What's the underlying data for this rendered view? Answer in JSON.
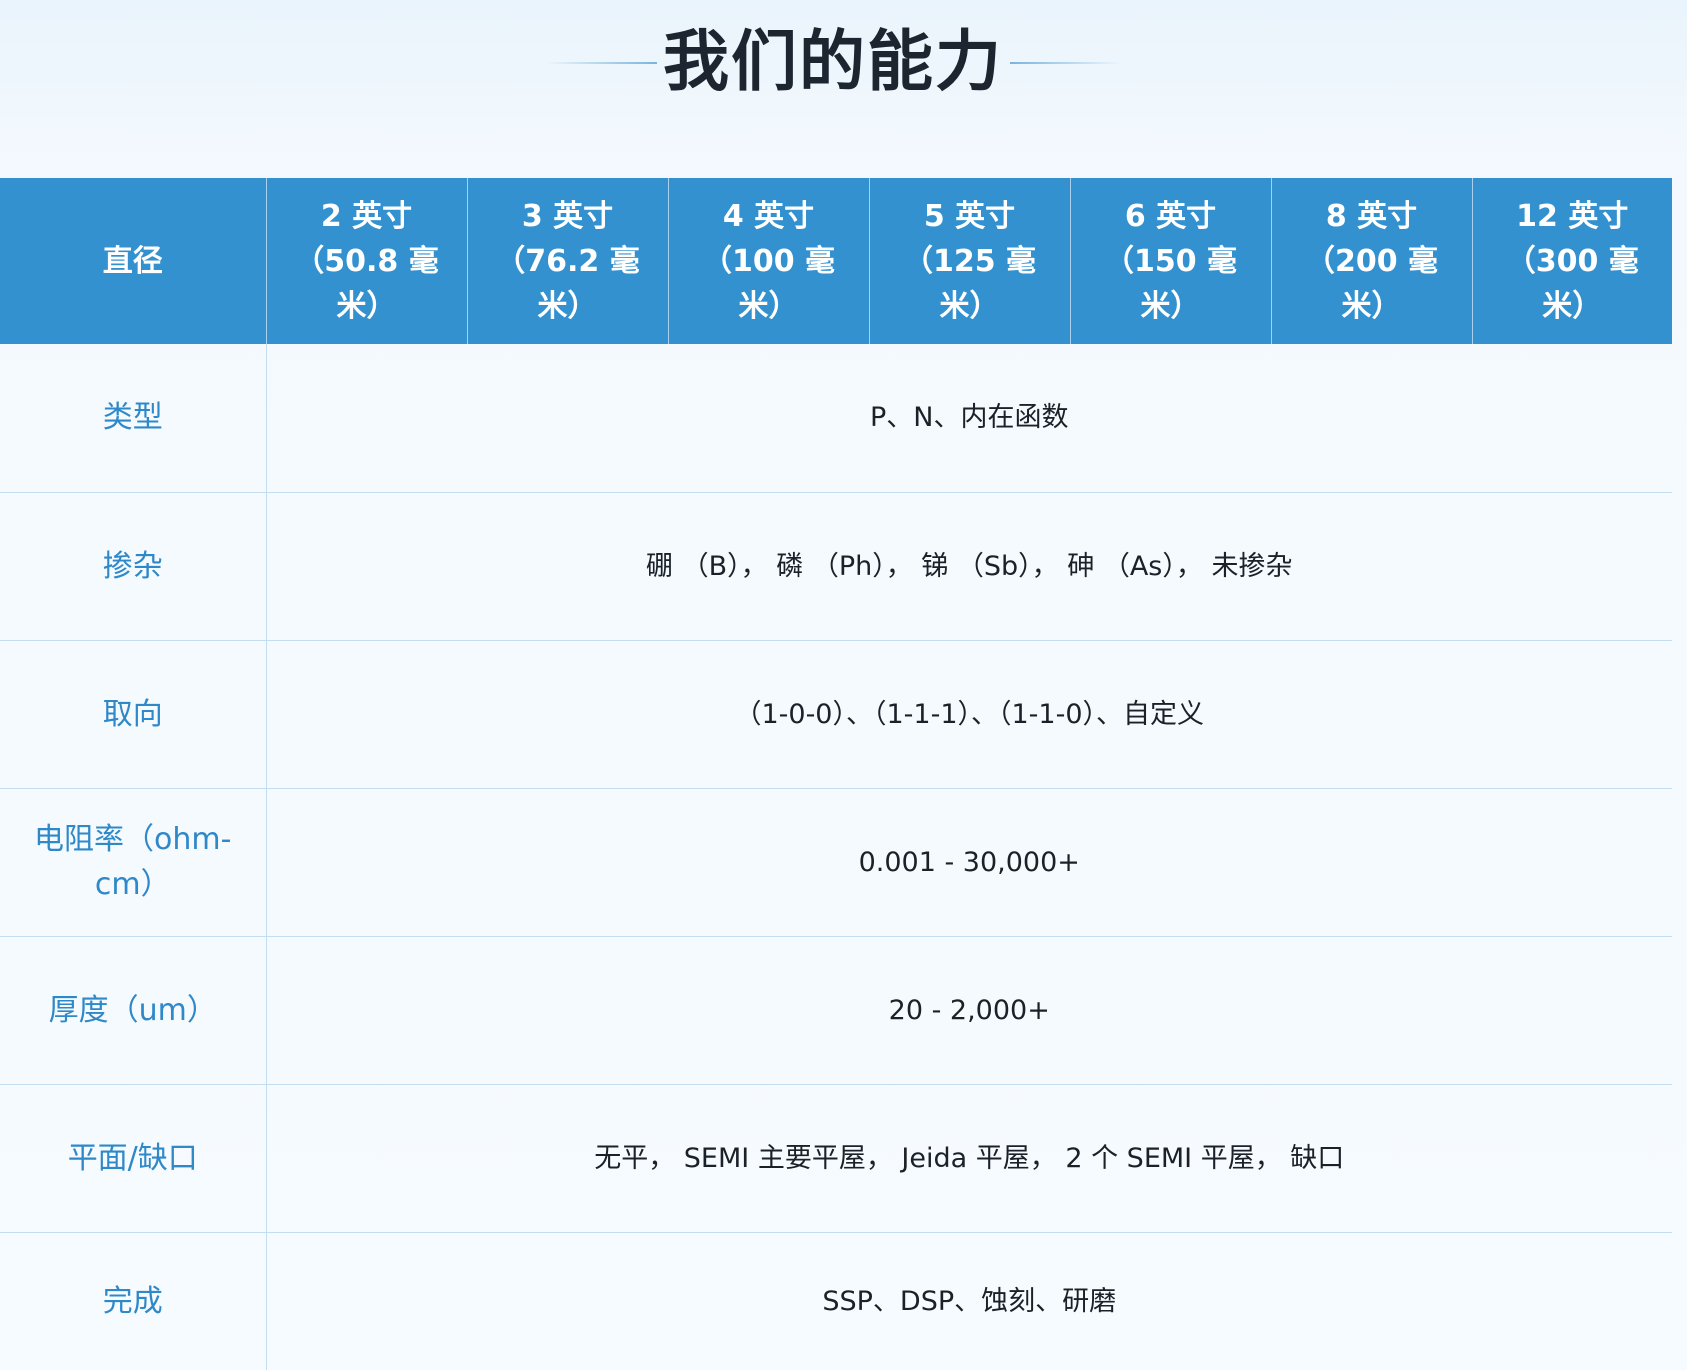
{
  "title": "我们的能力",
  "table": {
    "header_label": "直径",
    "columns": [
      "2 英寸（50.8 毫米）",
      "3 英寸（76.2 毫米）",
      "4 英寸（100 毫米）",
      "5 英寸（125 毫米）",
      "6 英寸（150 毫米）",
      "8 英寸（200 毫米）",
      "12 英寸（300 毫米）"
    ],
    "rows": [
      {
        "label": "类型",
        "value": "P、N、内在函数"
      },
      {
        "label": "掺杂",
        "value": "硼 （B）， 磷 （Ph）， 锑 （Sb）， 砷 （As）， 未掺杂"
      },
      {
        "label": "取向",
        "value": "（1-0-0）、（1-1-1）、（1-1-0）、自定义"
      },
      {
        "label": "电阻率（ohm-cm）",
        "value": "0.001 - 30,000+"
      },
      {
        "label": "厚度（um）",
        "value": "20 - 2,000+"
      },
      {
        "label": "平面/缺口",
        "value": "无平， SEMI 主要平屋， Jeida 平屋， 2 个 SEMI 平屋， 缺口"
      },
      {
        "label": "完成",
        "value": "SSP、DSP、蚀刻、研磨"
      }
    ]
  }
}
